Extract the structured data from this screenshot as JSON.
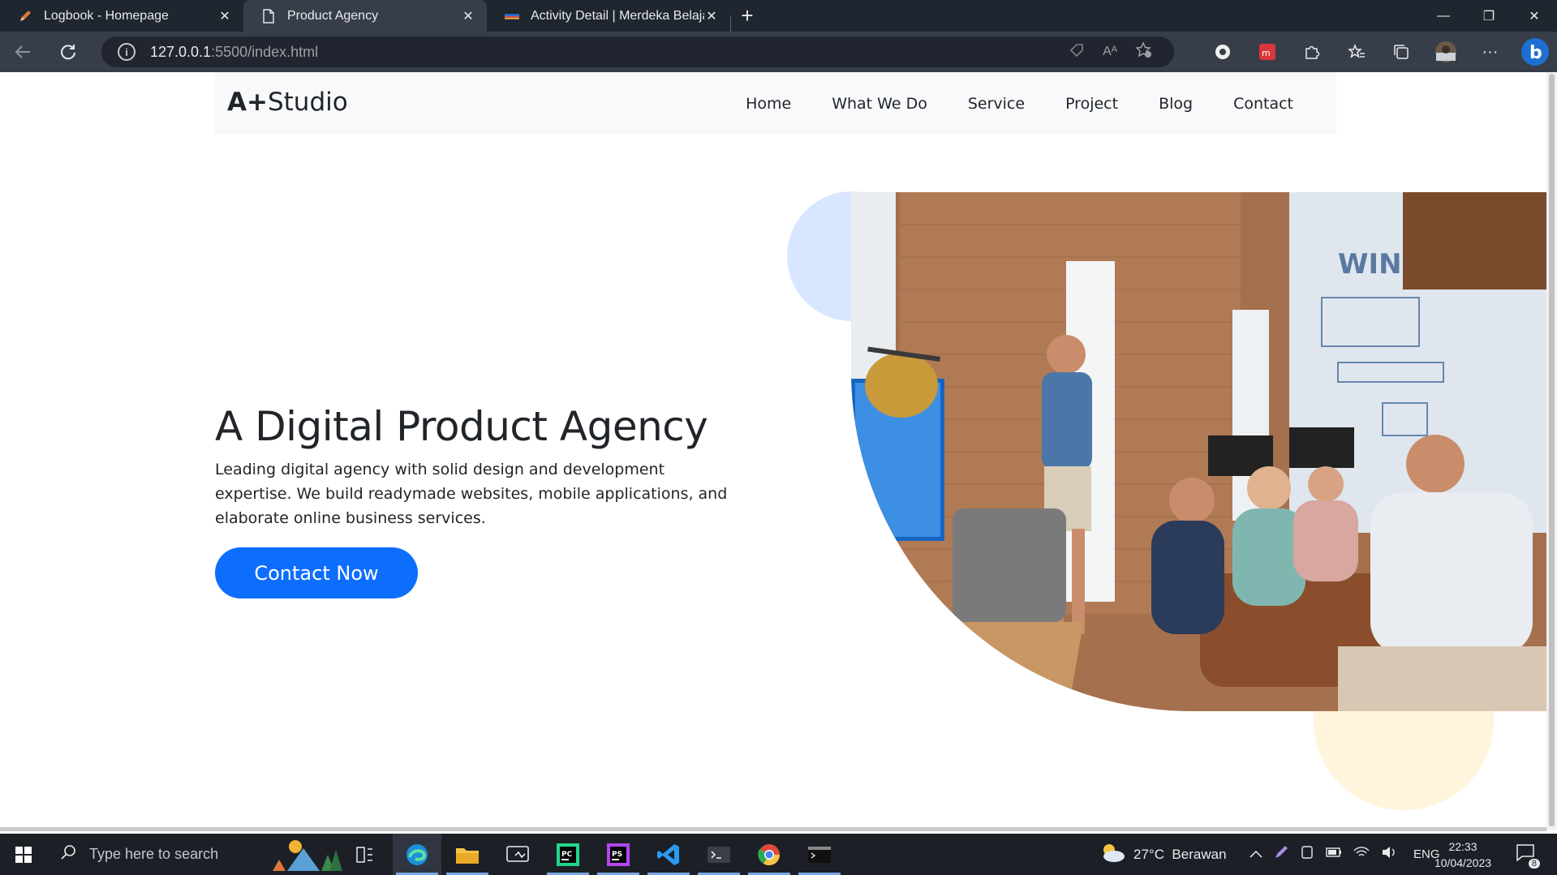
{
  "browser": {
    "tabs": [
      {
        "title": "Logbook - Homepage",
        "icon": "pencil-icon",
        "active": false
      },
      {
        "title": "Product Agency",
        "icon": "document-icon",
        "active": true
      },
      {
        "title": "Activity Detail | Merdeka Belajar",
        "icon": "kampus-merdeka-icon",
        "active": false
      }
    ],
    "url_host": "127.0.0.1",
    "url_path": ":5500/index.html"
  },
  "site": {
    "brand_bold": "A+",
    "brand_rest": "Studio",
    "nav": [
      "Home",
      "What We Do",
      "Service",
      "Project",
      "Blog",
      "Contact"
    ],
    "hero_title": "A Digital Product Agency",
    "hero_description": "Leading digital agency with solid design and development expertise. We build readymade websites, mobile applications, and elaborate online business services.",
    "cta_label": "Contact Now",
    "colors": {
      "primary": "#0d6efd",
      "blob_blue": "#d9e6ff",
      "blob_yellow": "#fff5dc",
      "navbar_bg": "#f8f9fa"
    }
  },
  "taskbar": {
    "search_placeholder": "Type here to search",
    "weather": "27°C  Berawan",
    "language": "ENG",
    "time": "22:33",
    "date": "10/04/2023",
    "notification_count": "8"
  }
}
